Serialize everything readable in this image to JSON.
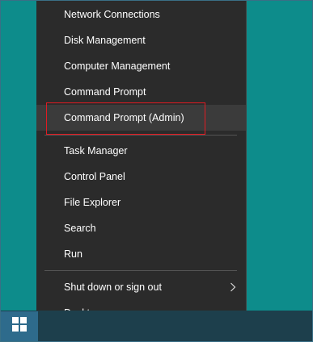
{
  "menu": {
    "items": [
      {
        "label": "Network Connections"
      },
      {
        "label": "Disk Management"
      },
      {
        "label": "Computer Management"
      },
      {
        "label": "Command Prompt"
      },
      {
        "label": "Command Prompt (Admin)"
      },
      {
        "label": "Task Manager"
      },
      {
        "label": "Control Panel"
      },
      {
        "label": "File Explorer"
      },
      {
        "label": "Search"
      },
      {
        "label": "Run"
      },
      {
        "label": "Shut down or sign out",
        "submenu_icon": "chevron-right-icon"
      },
      {
        "label": "Desktop"
      }
    ]
  },
  "taskbar": {
    "start_icon": "windows-logo-icon"
  },
  "colors": {
    "desktop": "#0d8c8b",
    "menu_bg": "#2b2b2b",
    "menu_hover": "#3b3b3b",
    "highlight_border": "#e11b22",
    "taskbar": "#1d3f4c",
    "start_button": "#2e6b8c"
  }
}
